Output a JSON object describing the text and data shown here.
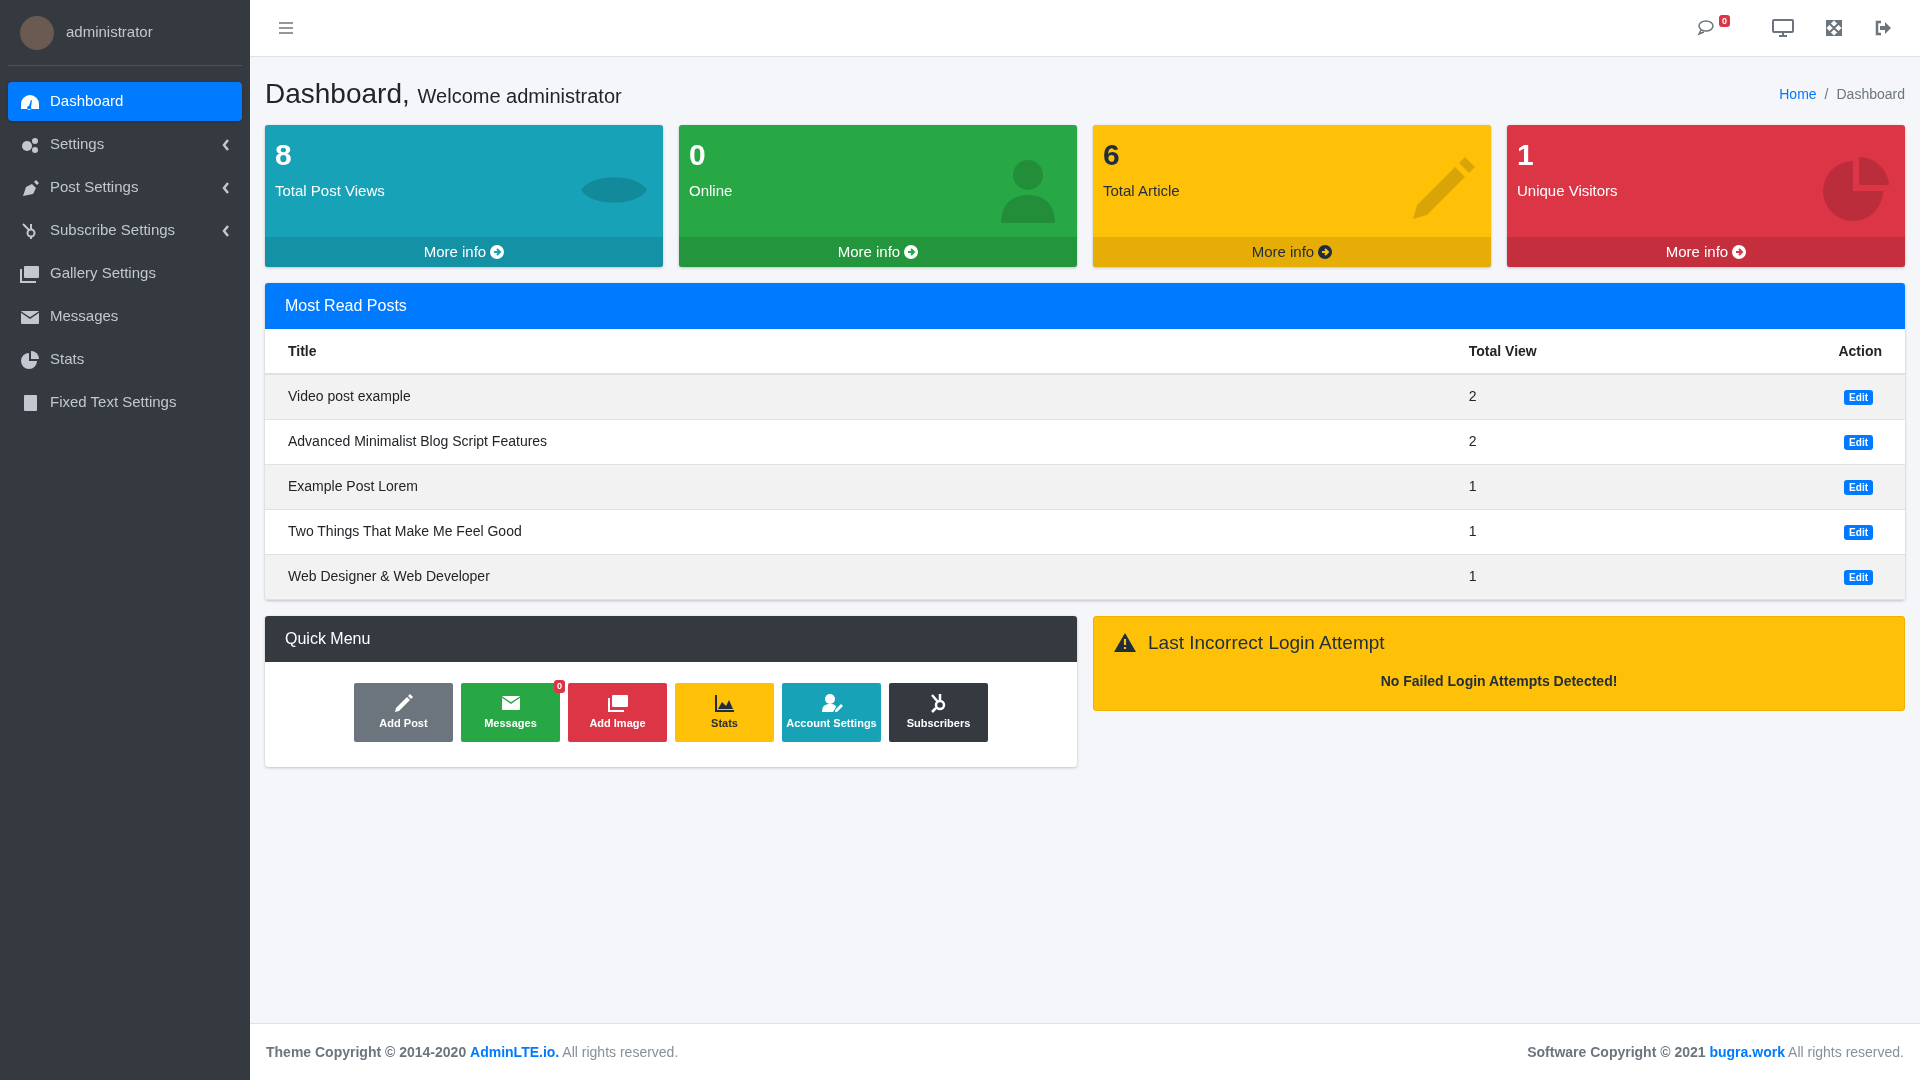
{
  "user": {
    "name": "administrator"
  },
  "sidebar": {
    "items": [
      {
        "label": "Dashboard",
        "selected": true,
        "has_submenu": false
      },
      {
        "label": "Settings",
        "selected": false,
        "has_submenu": true
      },
      {
        "label": "Post Settings",
        "selected": false,
        "has_submenu": true
      },
      {
        "label": "Subscribe Settings",
        "selected": false,
        "has_submenu": true
      },
      {
        "label": "Gallery Settings",
        "selected": false,
        "has_submenu": false
      },
      {
        "label": "Messages",
        "selected": false,
        "has_submenu": false
      },
      {
        "label": "Stats",
        "selected": false,
        "has_submenu": false
      },
      {
        "label": "Fixed Text Settings",
        "selected": false,
        "has_submenu": false
      }
    ]
  },
  "topbar": {
    "notification_count": "0"
  },
  "page": {
    "title": "Dashboard,",
    "subtitle": "Welcome administrator"
  },
  "breadcrumb": {
    "separator": "/",
    "items": [
      {
        "label": "Home",
        "selected": false
      },
      {
        "label": "Dashboard",
        "selected": true
      }
    ]
  },
  "stat_boxes": [
    {
      "value": "8",
      "label": "Total Post Views",
      "link": "More info",
      "color": "#17a2b8"
    },
    {
      "value": "0",
      "label": "Online",
      "link": "More info",
      "color": "#28a745"
    },
    {
      "value": "6",
      "label": "Total Article",
      "link": "More info",
      "color": "#ffc107"
    },
    {
      "value": "1",
      "label": "Unique Visitors",
      "link": "More info",
      "color": "#dc3545"
    }
  ],
  "most_read": {
    "title": "Most Read Posts",
    "columns": [
      "Title",
      "Total View",
      "Action"
    ],
    "rows": [
      {
        "title": "Video post example",
        "views": "2",
        "action": "Edit"
      },
      {
        "title": "Advanced Minimalist Blog Script Features",
        "views": "2",
        "action": "Edit"
      },
      {
        "title": "Example Post Lorem",
        "views": "1",
        "action": "Edit"
      },
      {
        "title": "Two Things That Make Me Feel Good",
        "views": "1",
        "action": "Edit"
      },
      {
        "title": "Web Designer & Web Developer",
        "views": "1",
        "action": "Edit"
      }
    ]
  },
  "quick_menu": {
    "title": "Quick Menu",
    "buttons": [
      {
        "label": "Add Post",
        "color": "#6c757d"
      },
      {
        "label": "Messages",
        "color": "#28a745",
        "badge": "0"
      },
      {
        "label": "Add Image",
        "color": "#dc3545"
      },
      {
        "label": "Stats",
        "color": "#ffc107"
      },
      {
        "label": "Account Settings",
        "color": "#17a2b8"
      },
      {
        "label": "Subscribers",
        "color": "#343a40"
      }
    ]
  },
  "login_alert": {
    "title": "Last Incorrect Login Attempt",
    "message": "No Failed Login Attempts Detected!"
  },
  "footer": {
    "left": {
      "prefix": "**Theme Copyright © 2014-2020**",
      "link": "AdminLTE.io.",
      "suffix": "All rights reserved."
    },
    "right": {
      "prefix": "**Software Copyright © 2021**",
      "link": "bugra.work",
      "suffix": "All rights reserved."
    }
  }
}
